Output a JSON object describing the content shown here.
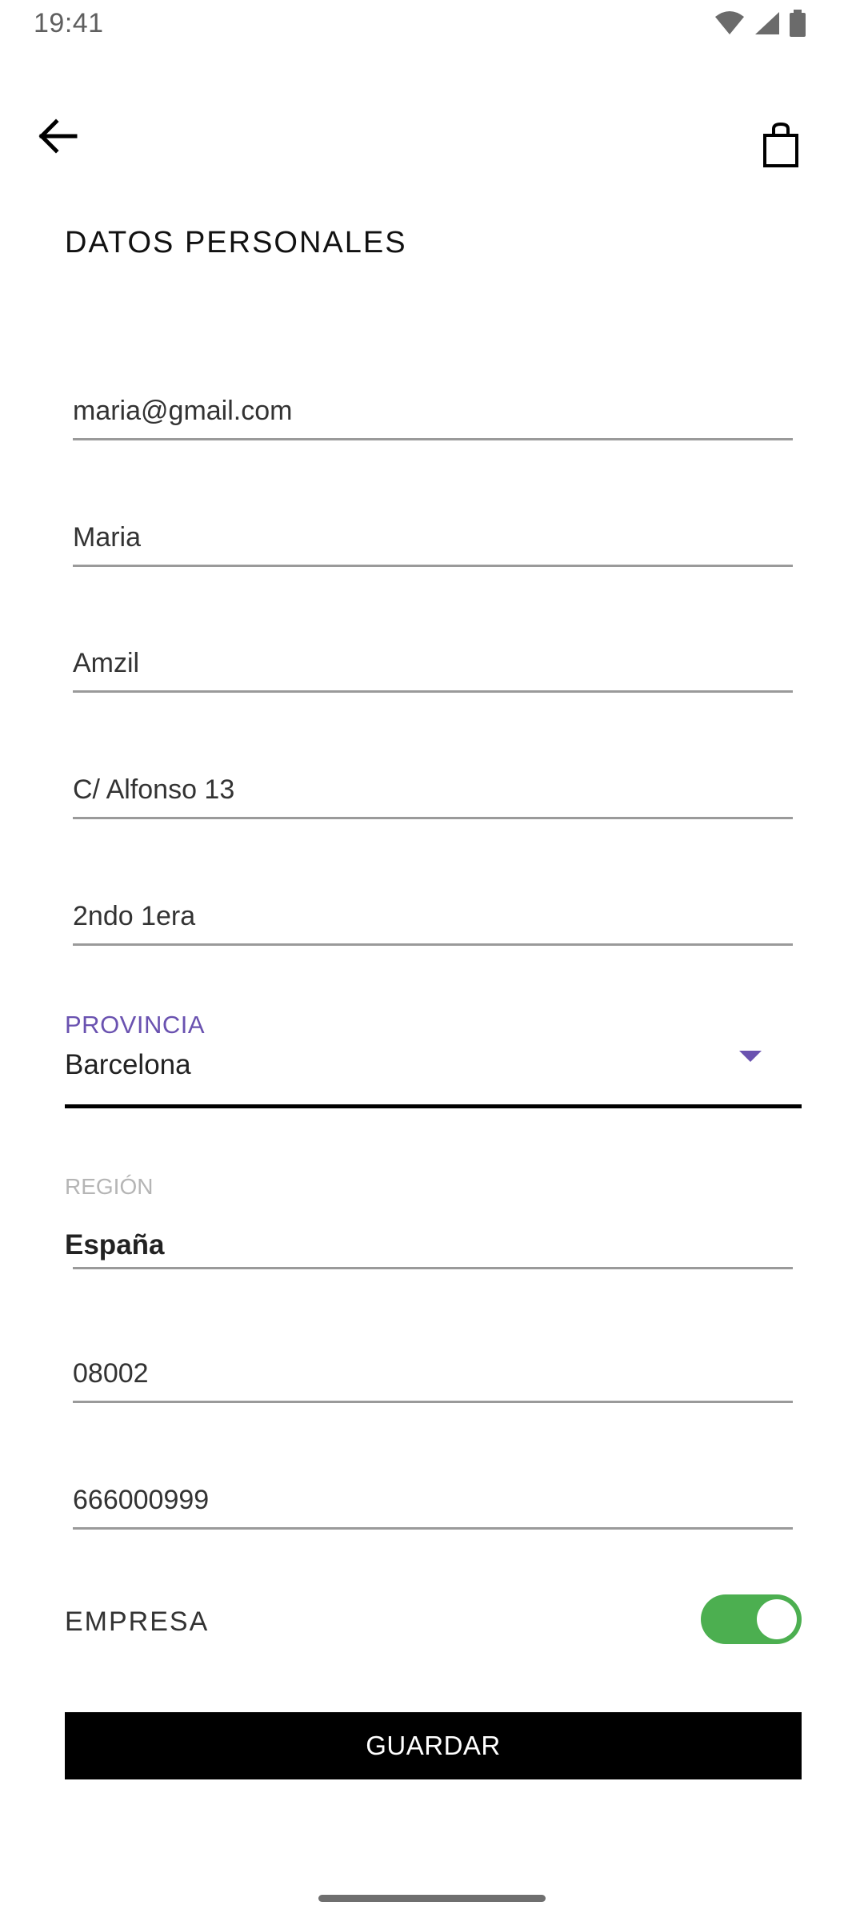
{
  "status_bar": {
    "time": "19:41",
    "icons": [
      "wifi-icon",
      "signal-icon",
      "battery-icon"
    ]
  },
  "app_bar": {
    "back_icon": "arrow-left-icon",
    "cart_icon": "shopping-bag-icon"
  },
  "page": {
    "title": "DATOS PERSONALES"
  },
  "form": {
    "email": "maria@gmail.com",
    "first_name": "Maria",
    "last_name": "Amzil",
    "address_line1": "C/ Alfonso 13",
    "address_line2": "2ndo 1era",
    "province": {
      "label": "PROVINCIA",
      "value": "Barcelona"
    },
    "region": {
      "label": "REGIÓN",
      "value": "España"
    },
    "postal_code": "08002",
    "phone": "666000999",
    "company": {
      "label": "EMPRESA",
      "enabled": true
    },
    "save_label": "GUARDAR"
  },
  "colors": {
    "accent": "#6a52b0",
    "toggle_on": "#4caf50",
    "button_bg": "#000000"
  }
}
